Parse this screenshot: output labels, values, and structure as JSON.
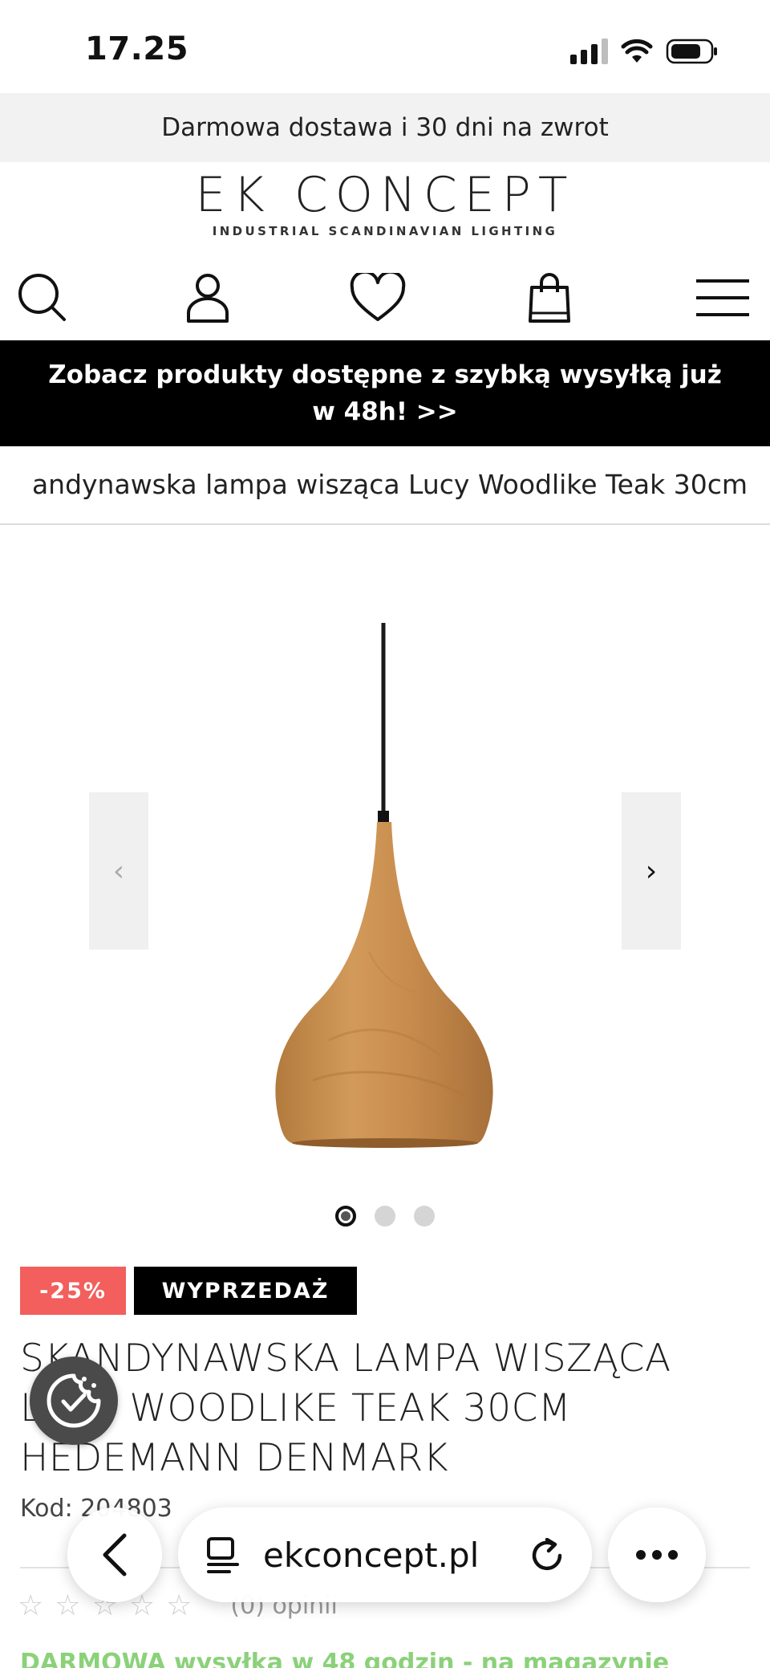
{
  "status_bar": {
    "time": "17.25"
  },
  "promo_top": {
    "text": "Darmowa dostawa i 30 dni na zwrot"
  },
  "logo": {
    "name": "EK CONCEPT",
    "tagline": "INDUSTRIAL SCANDINAVIAN LIGHTING"
  },
  "header_icons": [
    "search-icon",
    "user-icon",
    "heart-icon",
    "bag-icon",
    "menu-icon"
  ],
  "banner": {
    "text": "Zobacz produkty dostępne z szybką wysyłką już w 48h! >>"
  },
  "breadcrumb": {
    "text": "andynawska lampa wisząca Lucy Woodlike Teak 30cm"
  },
  "gallery": {
    "prev_label": "‹",
    "next_label": "›",
    "image_count": 3,
    "active_index": 0
  },
  "badges": {
    "discount": "-25%",
    "sale": "WYPRZEDAŻ"
  },
  "product": {
    "title": "SKANDYNAWSKA LAMPA WISZĄCA LUCY WOODLIKE TEAK 30CM HEDEMANN DENMARK",
    "code": "Kod: 204803",
    "rating_stars": 0,
    "rating_max": 5,
    "reviews": "(0) opinii",
    "delivery": "DARMOWA wysyłka w 48 godzin - na magazynie"
  },
  "browser": {
    "url": "ekconcept.pl"
  },
  "colors": {
    "discount_badge": "#f25f5c",
    "sale_badge": "#000000",
    "banner_bg": "#000000",
    "promo_bg": "#f2f2f2",
    "delivery_text": "#8bd17a"
  }
}
